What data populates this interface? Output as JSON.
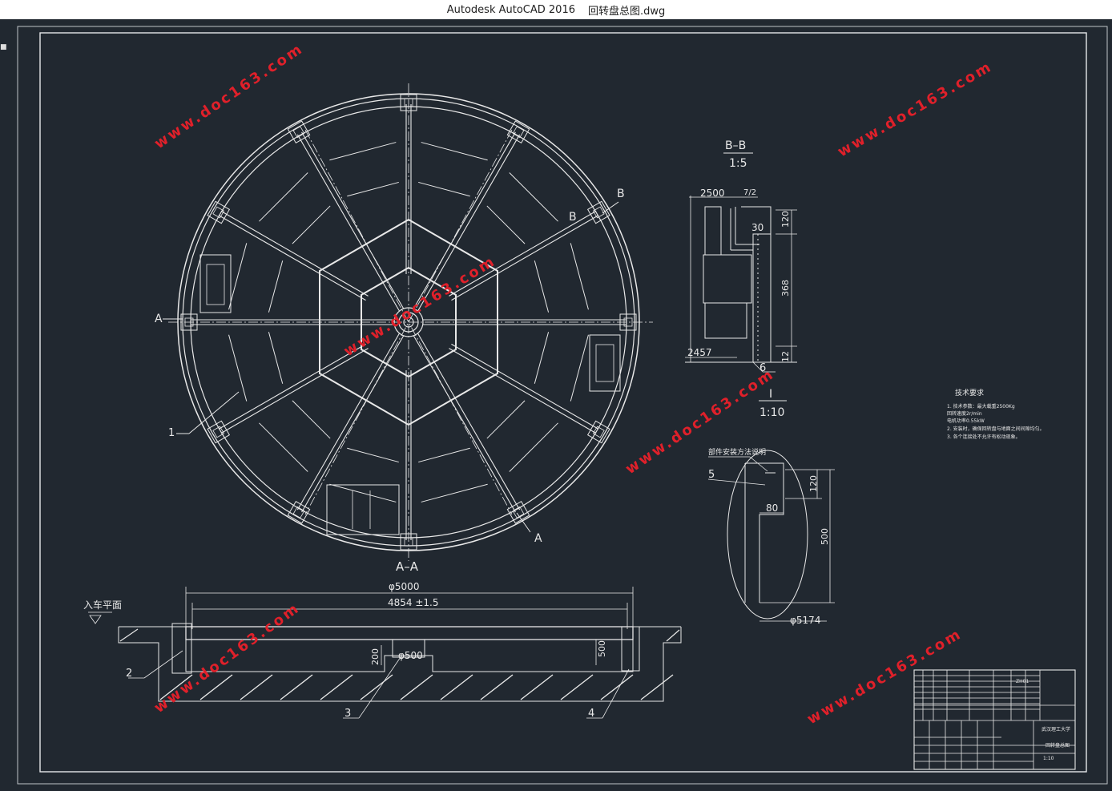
{
  "window": {
    "app_title": "Autodesk AutoCAD 2016",
    "file_name": "回转盘总图.dwg"
  },
  "drawing": {
    "plan_labels": {
      "section_a_left": "A",
      "section_a_bottom": "A",
      "section_b_top": "B",
      "section_b_mid": "B",
      "section_aa": "A–A"
    },
    "part_numbers": [
      "1",
      "2",
      "3",
      "4",
      "5",
      "6"
    ],
    "section_bb": {
      "title": "B–B",
      "scale": "1:5",
      "dim_top": "2500",
      "dim_frac": "7/2",
      "dim_30": "30",
      "dim_120": "120",
      "dim_368": "368",
      "dim_12": "12",
      "dim_bottom": "2457"
    },
    "detail_i": {
      "title": "I",
      "scale": "1:10",
      "note": "部件安装方法说明",
      "dim_120": "120",
      "dim_80": "80",
      "dim_500": "500",
      "dim_dia": "φ5174"
    },
    "section_aa_dims": {
      "dia_outer": "φ5000",
      "dia_inner": "4854 ±1.5",
      "dim_500": "500",
      "dim_200": "200",
      "dia_center": "φ500",
      "ground_label": "入车平面"
    },
    "tech_requirements": {
      "title": "技术要求",
      "lines": [
        "1. 技术参数：最大载重2500Kg",
        "   回转速度2r/min",
        "   电机功率0.55kW",
        "2. 安装时，确保回转盘与地面之间间隙均匀。",
        "3. 各个连接处不允许有松动现象。"
      ]
    },
    "title_block": {
      "school": "武汉理工大学",
      "drawing_name": "回转盘总图",
      "scale": "1:10",
      "sheet_code": "ZH01"
    }
  },
  "watermark": {
    "text": "www.doc163.com",
    "color": "#e0202a"
  }
}
